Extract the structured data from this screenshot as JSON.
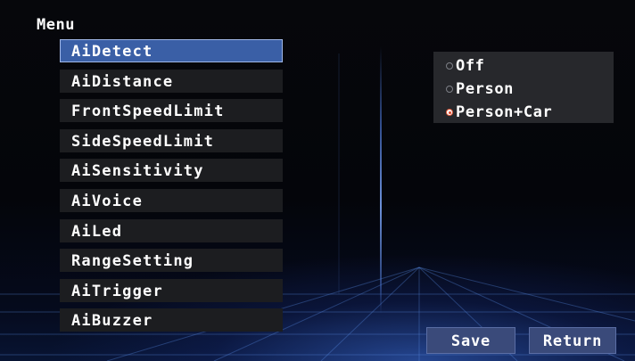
{
  "menu": {
    "title": "Menu",
    "items": [
      {
        "label": "AiDetect",
        "selected": true
      },
      {
        "label": "AiDistance",
        "selected": false
      },
      {
        "label": "FrontSpeedLimit",
        "selected": false
      },
      {
        "label": "SideSpeedLimit",
        "selected": false
      },
      {
        "label": "AiSensitivity",
        "selected": false
      },
      {
        "label": "AiVoice",
        "selected": false
      },
      {
        "label": "AiLed",
        "selected": false
      },
      {
        "label": "RangeSetting",
        "selected": false
      },
      {
        "label": "AiTrigger",
        "selected": false
      },
      {
        "label": "AiBuzzer",
        "selected": false
      }
    ]
  },
  "options": {
    "items": [
      {
        "label": "Off",
        "checked": false
      },
      {
        "label": "Person",
        "checked": false
      },
      {
        "label": "Person+Car",
        "checked": true
      }
    ]
  },
  "buttons": {
    "save_label": "Save",
    "return_label": "Return"
  },
  "colors": {
    "selected_item": "#3a5fa6",
    "item_background": "#1c1d20",
    "panel_background": "#27282c",
    "button_background": "#3a4a7a",
    "radio_checked": "#e0452a"
  }
}
